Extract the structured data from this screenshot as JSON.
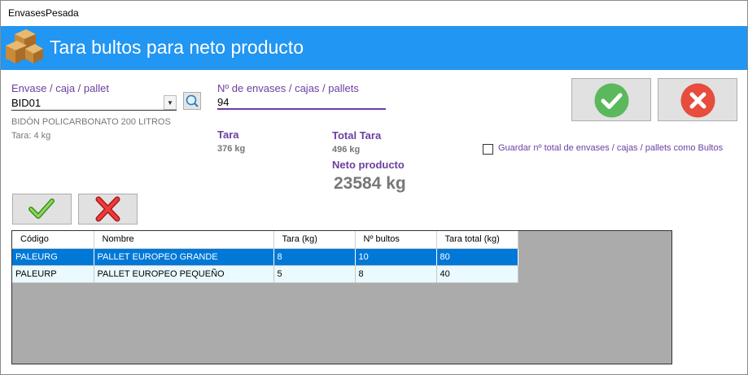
{
  "window": {
    "title": "EnvasesPesada"
  },
  "banner": {
    "title": "Tara bultos para neto producto",
    "icon": "boxes-icon"
  },
  "envase": {
    "label": "Envase / caja / pallet",
    "value": "BID01",
    "description": "BIDÓN POLICARBONATO 200 LITROS",
    "tara": "Tara: 4 kg"
  },
  "cantidad": {
    "label": "Nº de envases / cajas / pallets",
    "value": "94"
  },
  "totals": {
    "tara_label": "Tara",
    "tara_value": "376 kg",
    "total_tara_label": "Total Tara",
    "total_tara_value": "496 kg",
    "neto_label": "Neto producto",
    "neto_value": "23584 kg"
  },
  "options": {
    "guardar_label": "Guardar nº total de envases / cajas / pallets como Bultos",
    "guardar_checked": false
  },
  "colors": {
    "accent": "#2196f3",
    "label": "#6b3fa0",
    "ok": "#5cb85c",
    "cancel": "#e74c3c",
    "selected": "#0078d7"
  },
  "table": {
    "columns": [
      "Código",
      "Nombre",
      "Tara (kg)",
      "Nº bultos",
      "Tara total (kg)"
    ],
    "rows": [
      [
        "PALEURG",
        "PALLET EUROPEO GRANDE",
        "8",
        "10",
        "80"
      ],
      [
        "PALEURP",
        "PALLET EUROPEO PEQUEÑO",
        "5",
        "8",
        "40"
      ]
    ],
    "selected_row": 0
  }
}
